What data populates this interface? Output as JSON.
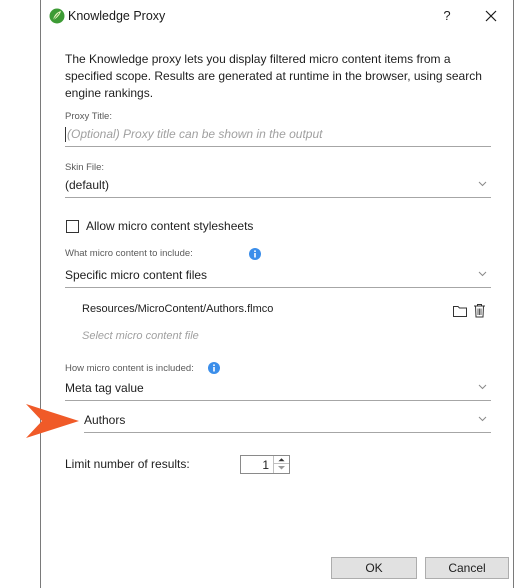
{
  "window": {
    "title": "Knowledge Proxy",
    "help_label": "?",
    "app_icon": "flare-leaf-icon",
    "close_icon": "close-icon"
  },
  "description": "The Knowledge proxy lets you display filtered micro content items from a specified scope. Results are generated at runtime in the browser, using search engine rankings.",
  "proxy_title": {
    "label": "Proxy Title:",
    "value": "",
    "placeholder": "(Optional) Proxy title can be shown in the output"
  },
  "skin_file": {
    "label": "Skin File:",
    "selected": "(default)"
  },
  "allow_stylesheets": {
    "label": "Allow micro content stylesheets",
    "checked": false
  },
  "micro_content_include": {
    "label": "What micro content to include:",
    "selected": "Specific micro content files",
    "files": [
      "Resources/MicroContent/Authors.flmco"
    ],
    "file_placeholder": "Select micro content file"
  },
  "how_included": {
    "label": "How micro content is included:",
    "selected": "Meta tag value",
    "meta_tag_selected": "Authors"
  },
  "limit_results": {
    "label": "Limit number of results:",
    "value": "1"
  },
  "buttons": {
    "ok": "OK",
    "cancel": "Cancel"
  },
  "colors": {
    "callout_arrow": "#f05a28",
    "info_icon": "#3b8eea",
    "app_icon_green": "#3d9b35"
  }
}
